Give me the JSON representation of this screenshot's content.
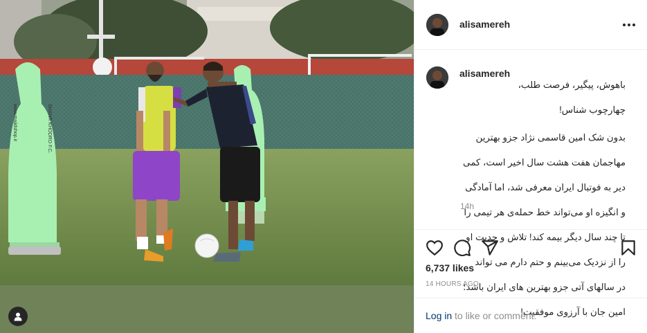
{
  "post": {
    "username": "alisamereh",
    "caption_lines": [
      "باهوش، پیگیر، فرصت طلب،",
      "چهارچوب شناس!",
      "بدون شک امین قاسمی نژاد جزو بهترین",
      "مهاجمان هفت هشت سال اخیر است، کمی",
      "دیر به فوتبال ایران معرفی شد، اما آمادگی",
      "و انگیزه او می‌تواند خط حمله‌ی هر تیمی را",
      "تا چند سال دیگر بیمه کند! تلاش و جدیت او",
      "را از نزدیک می‌بینم و حتم دارم می تواند",
      "در سالهای آتی جزو بهترین های ایران باشد؛",
      "امین جان با آرزوی موفقیت!"
    ],
    "time_ago": "14h",
    "likes": "6,737 likes",
    "date": "14 HOURS AGO",
    "login_link": "Log in",
    "login_suffix": " to like or comment."
  },
  "photo": {
    "dummy_text_1": "SHAHR KHODRO F.C.",
    "dummy_text_2": "www.majidshop.ir"
  },
  "icons": {
    "more": "more-options-icon",
    "like": "heart-icon",
    "comment": "comment-icon",
    "share": "share-icon",
    "save": "bookmark-icon",
    "tag": "user-tag-icon"
  }
}
